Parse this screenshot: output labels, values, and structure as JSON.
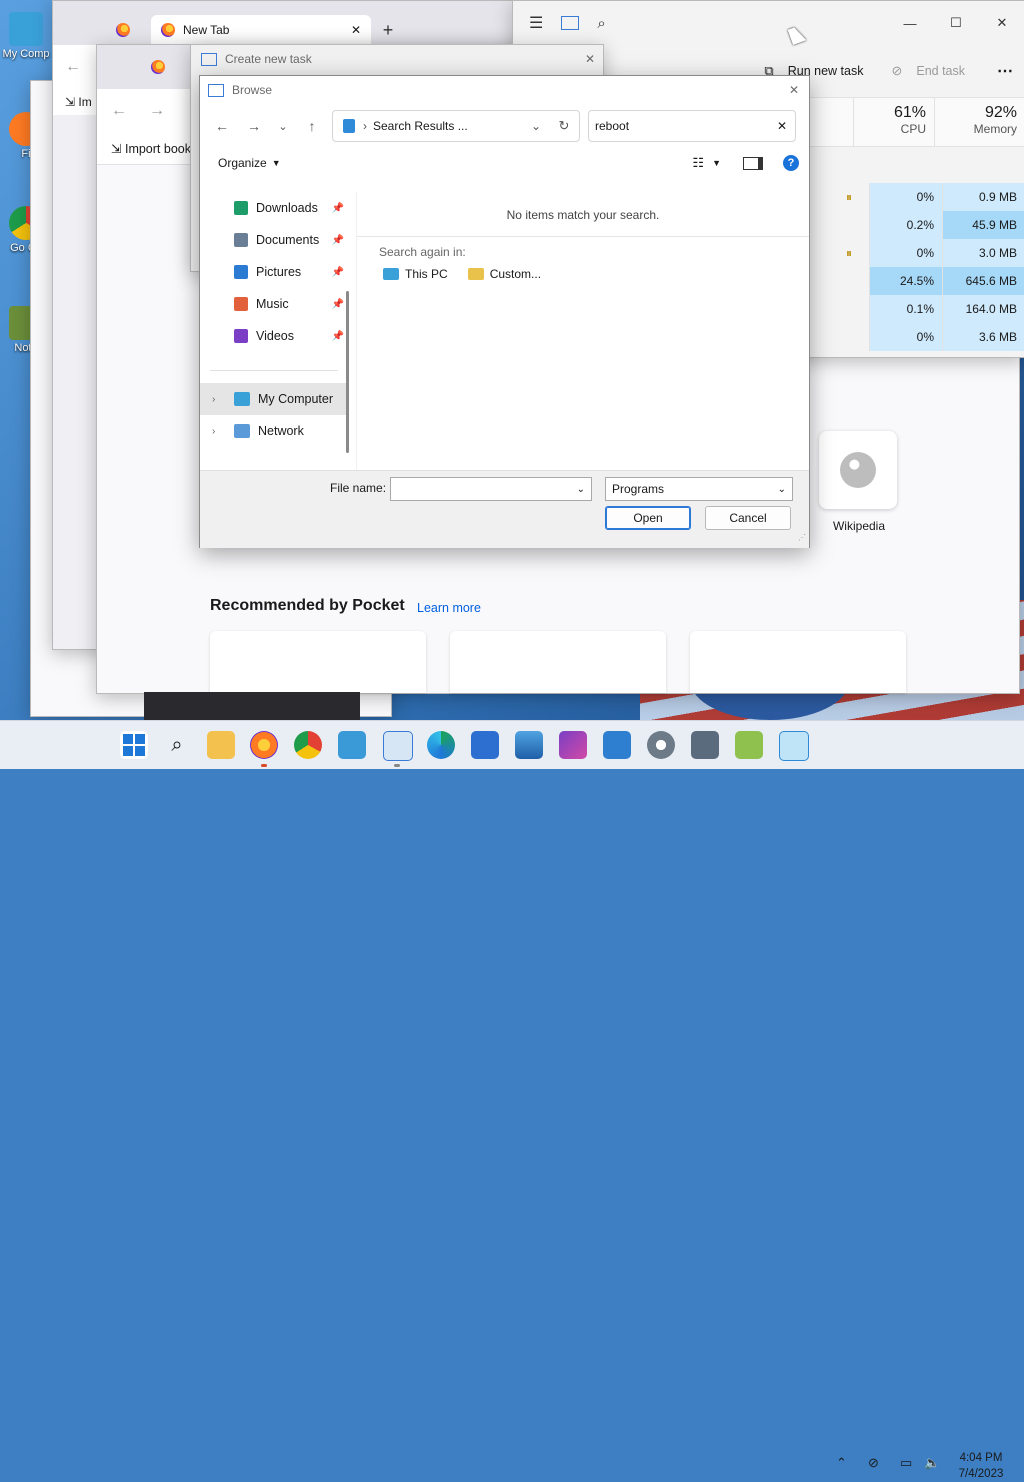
{
  "desktop": {
    "icons": [
      {
        "label": "My Comp",
        "color": "#3aa0d8"
      },
      {
        "label": "Fi",
        "color": "#ff7b23"
      },
      {
        "label": "Go Ch",
        "color": "#1e9c4a"
      },
      {
        "label": "Note",
        "color": "#6b8f3a"
      }
    ]
  },
  "firefox": {
    "tab_title": "New Tab",
    "new_tab_symbol": "+",
    "import_label": "Im",
    "import_bookmarks": "Import book",
    "recommended_title": "Recommended by Pocket",
    "learn_more": "Learn more",
    "wikipedia_label": "Wikipedia"
  },
  "create_task": {
    "title": "Create new task"
  },
  "task_manager": {
    "run_new_task": "Run new task",
    "end_task": "End task",
    "cpu_percent": "61%",
    "cpu_label": "CPU",
    "memory_percent": "92%",
    "memory_label": "Memory",
    "rows": [
      {
        "cpu": "0%",
        "mem": "0.9 MB",
        "paused": true
      },
      {
        "cpu": "0.2%",
        "mem": "45.9 MB",
        "paused": false
      },
      {
        "cpu": "0%",
        "mem": "3.0 MB",
        "paused": true
      },
      {
        "cpu": "24.5%",
        "mem": "645.6 MB",
        "paused": false
      },
      {
        "cpu": "0.1%",
        "mem": "164.0 MB",
        "paused": false
      },
      {
        "cpu": "0%",
        "mem": "3.6 MB",
        "paused": false
      }
    ]
  },
  "browse": {
    "title": "Browse",
    "address": "Search Results ...",
    "search_value": "reboot",
    "organize": "Organize",
    "nav": {
      "quick": [
        {
          "label": "Downloads",
          "color": "#1e9c6a"
        },
        {
          "label": "Documents",
          "color": "#6a7f96"
        },
        {
          "label": "Pictures",
          "color": "#2c7bd2"
        },
        {
          "label": "Music",
          "color": "#e2603c"
        },
        {
          "label": "Videos",
          "color": "#7a3fc4"
        }
      ],
      "my_computer": "My Computer",
      "network": "Network"
    },
    "no_items": "No items match your search.",
    "search_again": "Search again in:",
    "this_pc": "This PC",
    "custom": "Custom...",
    "file_name_label": "File name:",
    "file_name_value": "",
    "file_type": "Programs",
    "open": "Open",
    "cancel": "Cancel"
  },
  "taskbar": {
    "time": "4:04 PM",
    "date": "7/4/2023"
  }
}
